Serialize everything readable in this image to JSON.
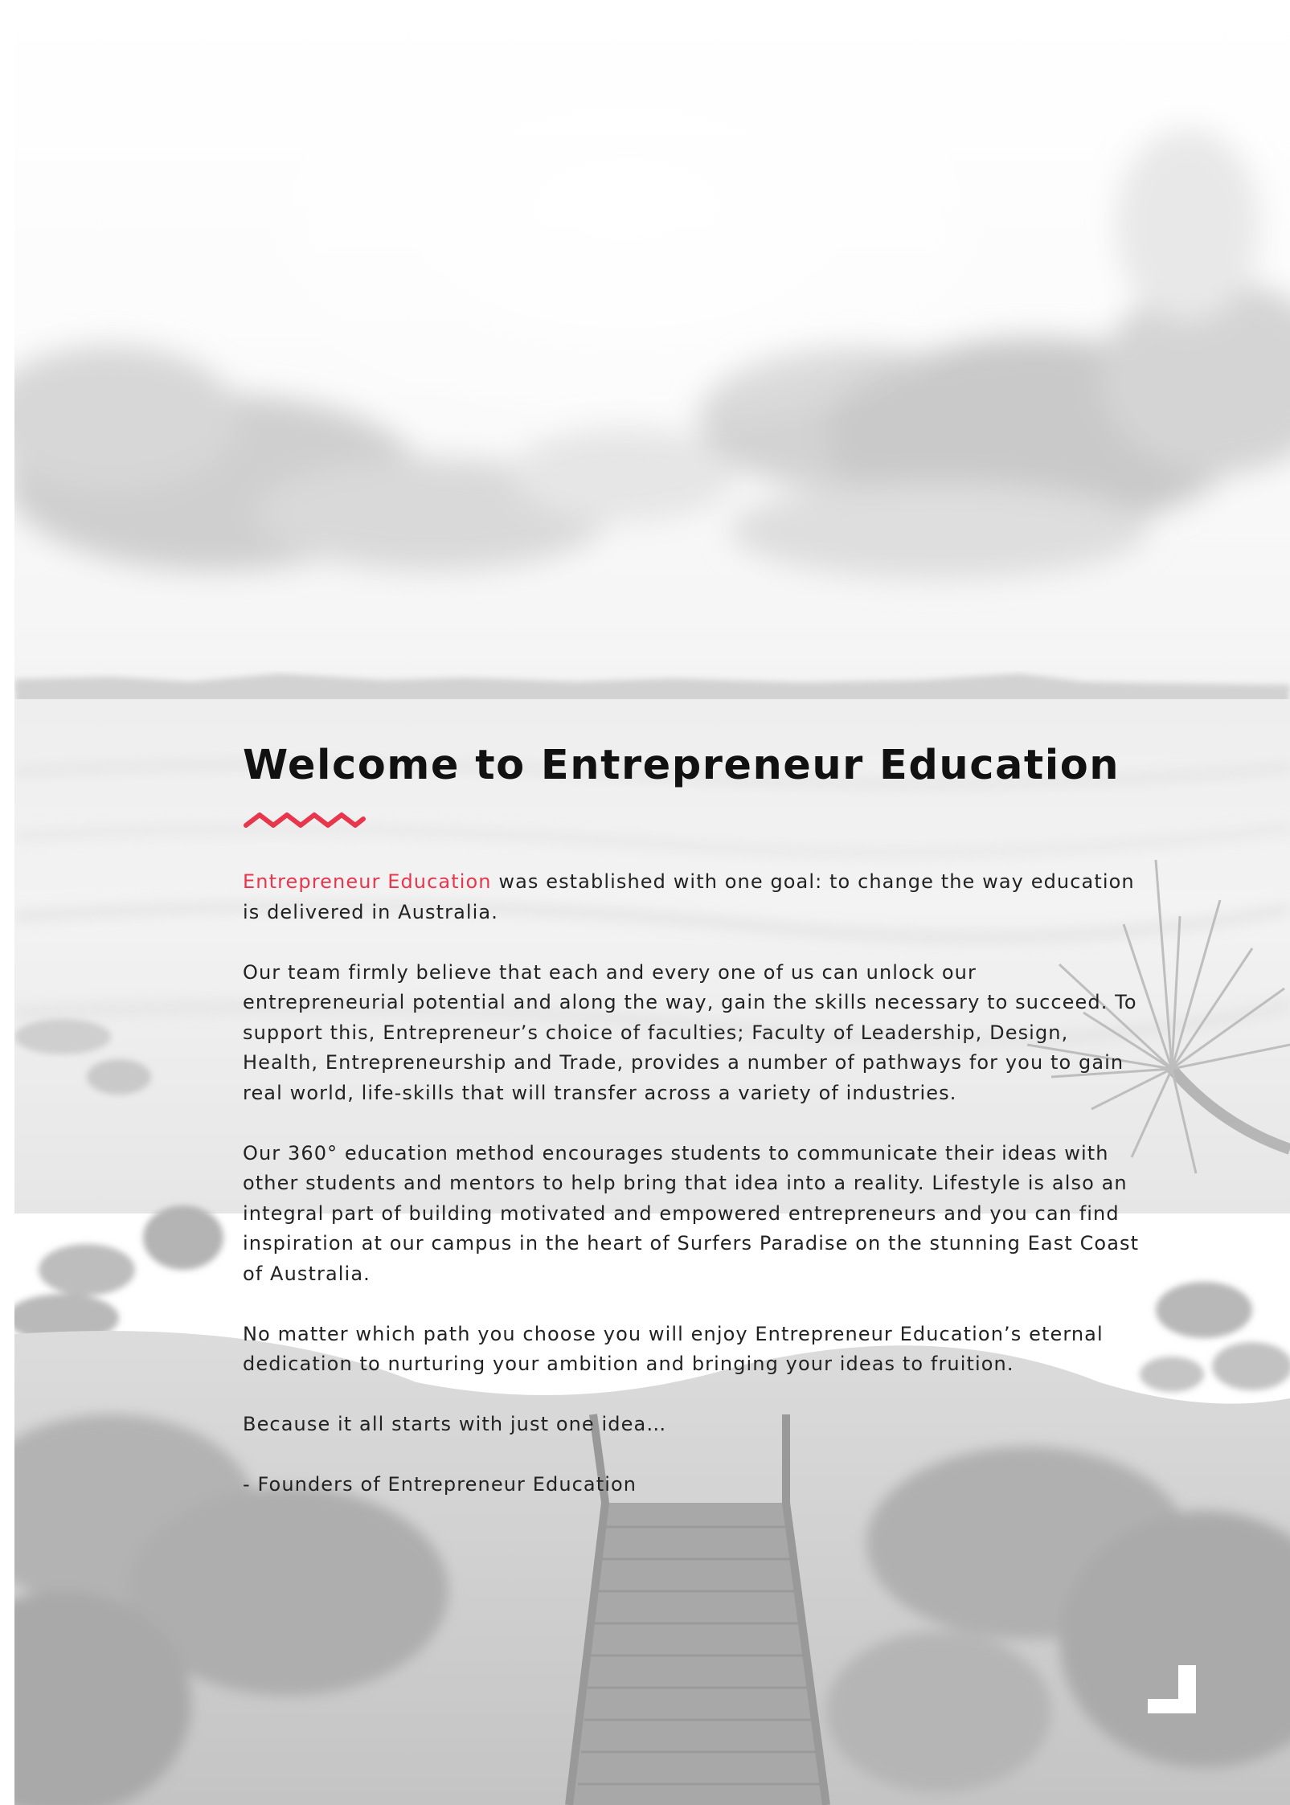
{
  "colors": {
    "accent": "#e8364d",
    "title": "#111111",
    "body_text": "#222222",
    "corner_mark": "#ffffff"
  },
  "icons": {
    "divider": "zigzag-divider-icon",
    "corner": "corner-bracket-icon"
  },
  "page": {
    "title": "Welcome to Entrepreneur Education",
    "intro": {
      "highlight": "Entrepreneur Education",
      "rest": " was established with one goal: to change the way education is delivered in Australia."
    },
    "paragraphs": [
      "Our team firmly believe that each and every one of us can unlock our entrepreneurial potential and along the way, gain the skills necessary to succeed. To support this, Entrepreneur’s choice of faculties; Faculty of Leadership, Design, Health, Entrepreneurship and Trade, provides a number of pathways for you to gain real world, life-skills that will transfer across a variety of industries.",
      "Our 360° education method encourages students to communicate their ideas with other students and mentors to help bring that idea into a reality. Lifestyle is also an integral part of building motivated and empowered entrepreneurs and you can find inspiration at our campus in the heart of Surfers Paradise on the stunning East Coast of Australia.",
      "No matter which path you choose you will enjoy Entrepreneur Education’s eternal dedication to nurturing your ambition and bringing your ideas to fruition.",
      "Because it all starts with just one idea…",
      "- Founders of Entrepreneur Education"
    ]
  }
}
